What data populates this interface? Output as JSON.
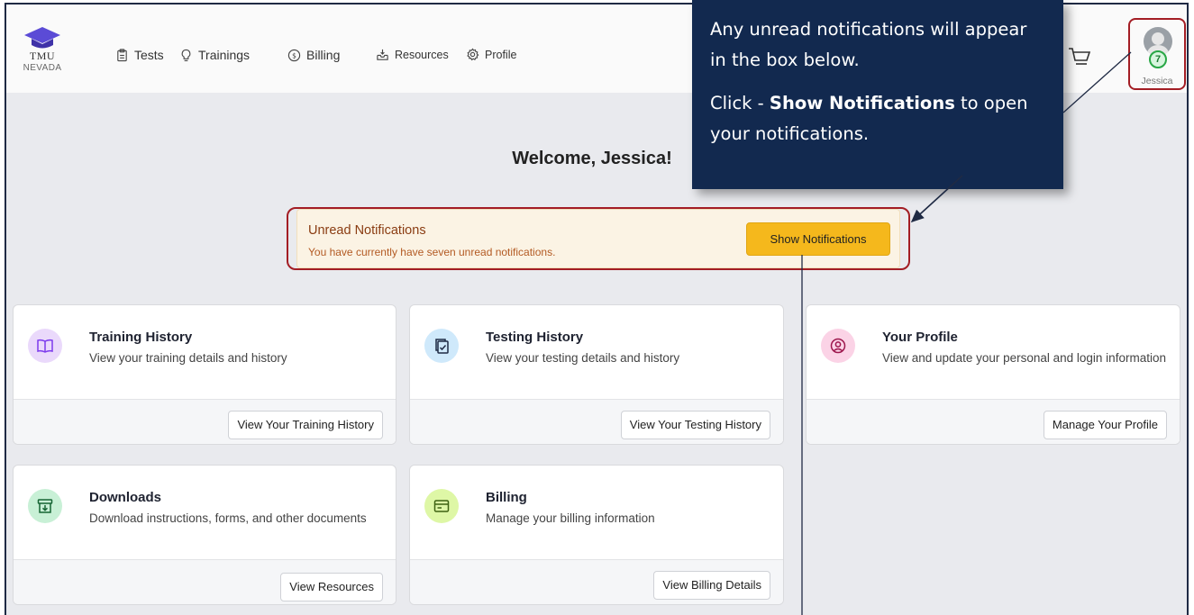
{
  "logo": {
    "brand": "TMU",
    "state": "NEVADA",
    "icon": "graduation-cap-icon"
  },
  "nav": [
    {
      "label": "Tests",
      "icon": "clipboard-icon"
    },
    {
      "label": "Trainings",
      "icon": "lightbulb-icon"
    },
    {
      "label": "Billing",
      "icon": "dollar-circle-icon"
    },
    {
      "label": "Resources",
      "icon": "inbox-icon"
    },
    {
      "label": "Profile",
      "icon": "gear-icon"
    }
  ],
  "user": {
    "name": "Jessica",
    "notification_count": "7"
  },
  "welcome": "Welcome, Jessica!",
  "notifications": {
    "title": "Unread Notifications",
    "message": "You have currently have seven unread notifications.",
    "button": "Show Notifications"
  },
  "callout": {
    "line1": "Any unread notifications will appear in the box below.",
    "line2_prefix": "Click - ",
    "line2_bold": "Show Notifications",
    "line2_suffix": " to open your notifications."
  },
  "cards": [
    {
      "title": "Training History",
      "description": "View your training details and history",
      "button": "View Your Training History",
      "icon": "book-icon",
      "icon_bg": "#ead9fb",
      "icon_color": "#7c3aed"
    },
    {
      "title": "Testing History",
      "description": "View your testing details and history",
      "button": "View Your Testing History",
      "icon": "clipboard-check-icon",
      "icon_bg": "#cfe9fb",
      "icon_color": "#1f2a44"
    },
    {
      "title": "Your Profile",
      "description": "View and update your personal and login information",
      "button": "Manage Your Profile",
      "icon": "user-circle-icon",
      "icon_bg": "#fbd3e6",
      "icon_color": "#9d174d"
    },
    {
      "title": "Downloads",
      "description": "Download instructions, forms, and other documents",
      "button": "View Resources",
      "icon": "archive-download-icon",
      "icon_bg": "#c8f0d6",
      "icon_color": "#166534"
    },
    {
      "title": "Billing",
      "description": "Manage your billing information",
      "button": "View Billing Details",
      "icon": "credit-card-icon",
      "icon_bg": "#def7a6",
      "icon_color": "#3f6212"
    }
  ],
  "colors": {
    "accent": "#f5b81c",
    "callout_bg": "#12294f",
    "highlight_border": "#a31d24",
    "page_bg": "#e9eaee"
  }
}
